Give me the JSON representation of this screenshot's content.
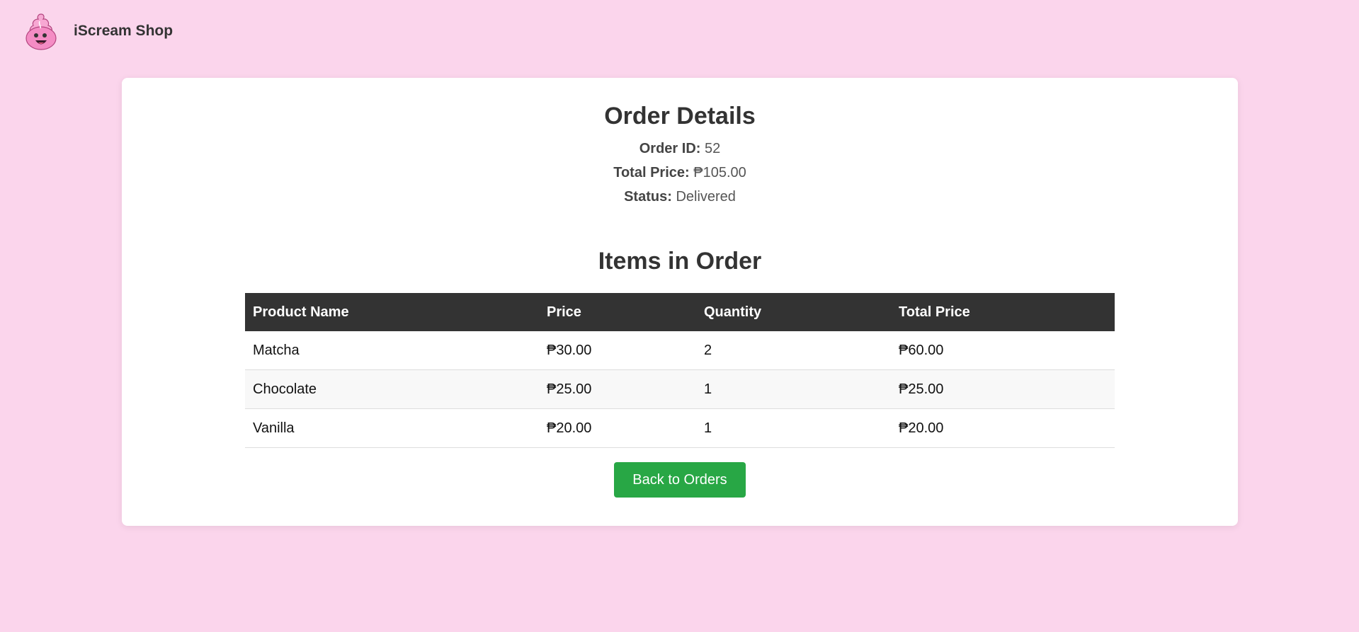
{
  "brand": {
    "name": "iScream Shop",
    "logo_icon": "ice-cream-mascot-icon"
  },
  "order": {
    "heading": "Order Details",
    "id_label": "Order ID:",
    "id_value": "52",
    "total_label": "Total Price:",
    "total_value": "₱105.00",
    "status_label": "Status:",
    "status_value": "Delivered"
  },
  "items_section": {
    "heading": "Items in Order",
    "columns": [
      "Product Name",
      "Price",
      "Quantity",
      "Total Price"
    ],
    "rows": [
      {
        "name": "Matcha",
        "price": "₱30.00",
        "quantity": "2",
        "total": "₱60.00"
      },
      {
        "name": "Chocolate",
        "price": "₱25.00",
        "quantity": "1",
        "total": "₱25.00"
      },
      {
        "name": "Vanilla",
        "price": "₱20.00",
        "quantity": "1",
        "total": "₱20.00"
      }
    ]
  },
  "actions": {
    "back_label": "Back to Orders"
  },
  "colors": {
    "page_background": "#fbd5ec",
    "header_row": "#333333",
    "button": "#28a745"
  }
}
